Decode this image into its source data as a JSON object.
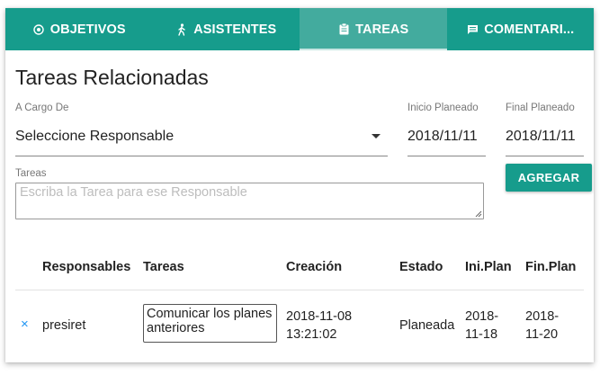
{
  "tabs": [
    {
      "label": "OBJETIVOS",
      "icon": "target-icon",
      "active": false
    },
    {
      "label": "ASISTENTES",
      "icon": "person-walking-icon",
      "active": false
    },
    {
      "label": "TAREAS",
      "icon": "clipboard-icon",
      "active": true
    },
    {
      "label": "COMENTARI...",
      "icon": "comment-icon",
      "active": false
    }
  ],
  "form": {
    "title": "Tareas Relacionadas",
    "responsable_label": "A Cargo De",
    "responsable_value": "Seleccione Responsable",
    "inicio_label": "Inicio Planeado",
    "inicio_value": "2018/11/11",
    "final_label": "Final Planeado",
    "final_value": "2018/11/11",
    "tareas_label": "Tareas",
    "tareas_placeholder": "Escriba la Tarea para ese Responsable",
    "add_button": "AGREGAR"
  },
  "table": {
    "headers": [
      "Responsables",
      "Tareas",
      "Creación",
      "Estado",
      "Ini.Plan",
      "Fin.Plan"
    ],
    "rows": [
      {
        "remove": "×",
        "responsable": "presiret",
        "tarea": "Comunicar los planes anteriores",
        "creacion_date": "2018-11-08",
        "creacion_time": "13:21:02",
        "estado": "Planeada",
        "ini_a": "2018-",
        "ini_b": "11-18",
        "fin_a": "2018-",
        "fin_b": "11-20"
      }
    ]
  },
  "colors": {
    "accent": "#169c8c",
    "active_tab": "#43ab9e",
    "remove_icon": "#2196f3"
  }
}
